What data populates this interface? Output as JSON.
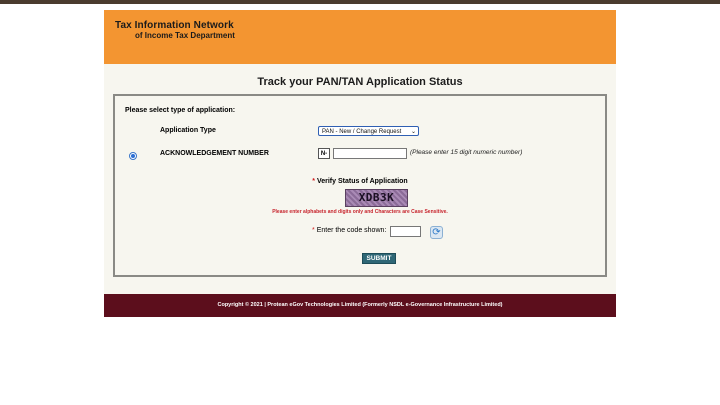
{
  "header": {
    "title_line1": "Tax Information Network",
    "title_line2": "of Income Tax Department",
    "bg_color": "#f39531"
  },
  "page_title": "Track your PAN/TAN Application Status",
  "form": {
    "select_type_label": "Please select type of application:",
    "application_type_label": "Application Type",
    "application_type_selected": "PAN - New / Change Request",
    "ack_label": "ACKNOWLEDGEMENT NUMBER",
    "ack_prefix": "N-",
    "ack_value": "",
    "ack_hint": "(Please enter 15 digit numeric number)",
    "verify_star": "*",
    "verify_label": "Verify Status of Application",
    "captcha_text": "XDB3K",
    "captcha_warning": "Please enter alphabets and digits only and Characters are Case Sensitive.",
    "code_star": "*",
    "code_label": "Enter the code shown:",
    "code_value": "",
    "refresh_icon": "refresh-icon",
    "submit_label": "SUBMIT"
  },
  "footer": {
    "text": "Copyright © 2021 | Protean eGov Technologies Limited (Formerly NSDL e-Governance Infrastructure Limited)",
    "bg_color": "#5c0e1c"
  }
}
